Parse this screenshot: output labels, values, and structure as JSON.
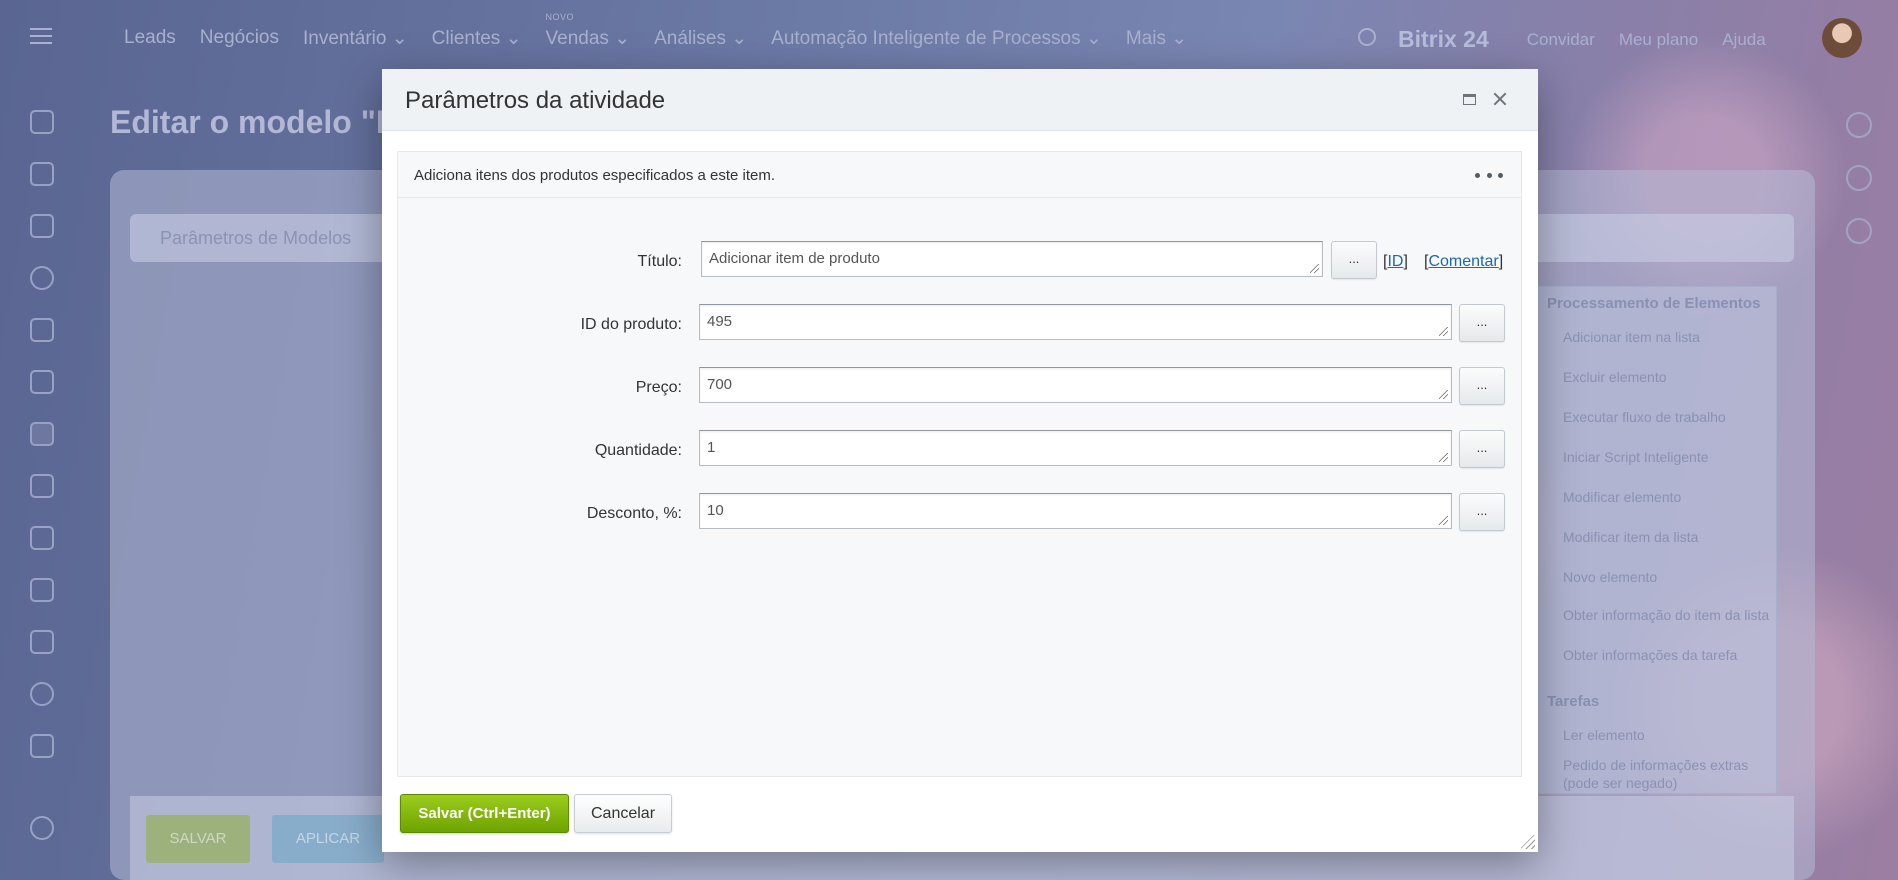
{
  "app": {
    "nav": [
      "Leads",
      "Negócios",
      "Inventário",
      "Clientes",
      "Vendas",
      "Análises",
      "Automação Inteligente de Processos",
      "Mais"
    ],
    "nav_badge": "NOVO",
    "brand": "Bitrix 24",
    "invite": "Convidar",
    "plan": "Meu plano",
    "help": "Ajuda",
    "page_title": "Editar o modelo \"N",
    "tab": "Parâmetros de Modelos",
    "save_button": "SALVAR",
    "apply_button": "APLICAR",
    "activity_groups": [
      {
        "title": "Processamento de Elementos",
        "items": [
          "Adicionar item na lista",
          "Excluir elemento",
          "Executar fluxo de trabalho",
          "Iniciar Script Inteligente",
          "Modificar elemento",
          "Modificar item da lista",
          "Novo elemento",
          "Obter informação do item da lista",
          "Obter informações da tarefa"
        ]
      },
      {
        "title": "Tarefas",
        "items": [
          "Ler elemento",
          "Pedido de informações extras",
          "(pode ser negado)"
        ]
      }
    ]
  },
  "dialog": {
    "title": "Parâmetros da atividade",
    "description": "Adiciona itens dos produtos especificados a este item.",
    "fields": [
      {
        "label": "Título:",
        "value": "Adicionar item de produto"
      },
      {
        "label": "ID do produto:",
        "value": "495"
      },
      {
        "label": "Preço:",
        "value": "700"
      },
      {
        "label": "Quantidade:",
        "value": "1"
      },
      {
        "label": "Desconto, %:",
        "value": "10"
      }
    ],
    "dots_label": "...",
    "id_link": "ID",
    "comment_link": "Comentar",
    "save_label": "Salvar (Ctrl+Enter)",
    "cancel_label": "Cancelar"
  }
}
